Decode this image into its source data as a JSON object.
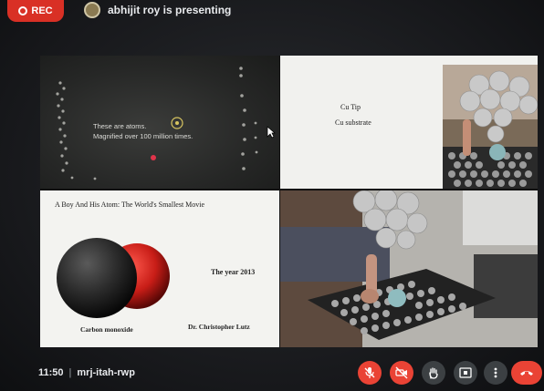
{
  "top_bar": {
    "rec_label": "REC",
    "presenter_text": "abhijit roy is presenting"
  },
  "slides": {
    "atoms_caption": [
      "These are atoms.",
      "Magnified over 100 million times."
    ],
    "tip_label": "Cu Tip",
    "substrate_label": "Cu substrate",
    "movie_title": "A Boy And His Atom: The World's Smallest Movie",
    "year_text": "The year 2013",
    "molecule_label": "Carbon monoxide",
    "author": "Dr. Christopher Lutz"
  },
  "bottom_bar": {
    "time": "11:50",
    "separator": "|",
    "meeting_code": "mrj-itah-rwp",
    "controls": [
      {
        "name": "mic-off-icon",
        "state": "off"
      },
      {
        "name": "camera-off-icon",
        "state": "off"
      },
      {
        "name": "raise-hand-icon",
        "state": "idle"
      },
      {
        "name": "present-icon",
        "state": "idle"
      },
      {
        "name": "more-options-icon",
        "state": "idle"
      },
      {
        "name": "end-call-icon",
        "state": "idle"
      }
    ]
  },
  "colors": {
    "rec": "#d93025",
    "muted_control": "#ea4335",
    "neutral_control": "#3c4043",
    "oxygen": "#c81d17",
    "carbon": "#2b2b2b"
  }
}
